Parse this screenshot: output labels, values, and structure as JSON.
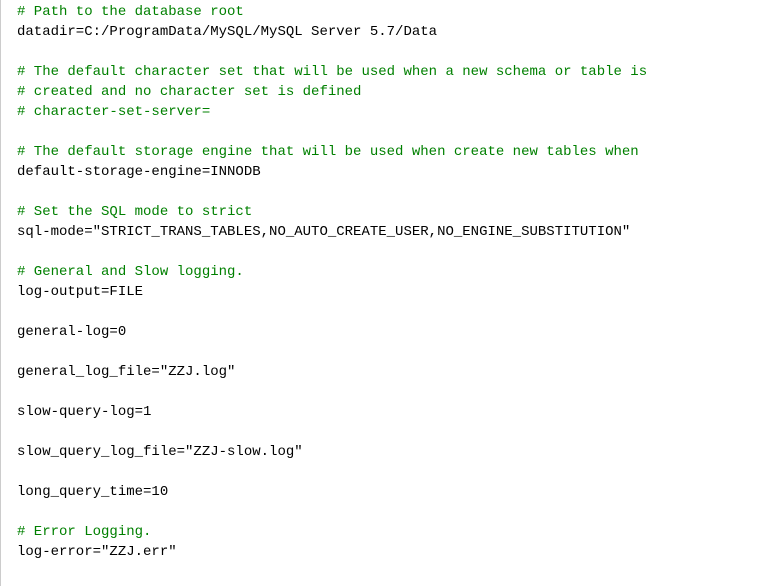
{
  "lines": [
    {
      "type": "comment",
      "text": "# Path to the database root"
    },
    {
      "type": "config",
      "text": "datadir=C:/ProgramData/MySQL/MySQL Server 5.7/Data"
    },
    {
      "type": "blank",
      "text": ""
    },
    {
      "type": "comment",
      "text": "# The default character set that will be used when a new schema or table is"
    },
    {
      "type": "comment",
      "text": "# created and no character set is defined"
    },
    {
      "type": "comment",
      "text": "# character-set-server="
    },
    {
      "type": "blank",
      "text": ""
    },
    {
      "type": "comment",
      "text": "# The default storage engine that will be used when create new tables when"
    },
    {
      "type": "config",
      "text": "default-storage-engine=INNODB"
    },
    {
      "type": "blank",
      "text": ""
    },
    {
      "type": "comment",
      "text": "# Set the SQL mode to strict"
    },
    {
      "type": "config",
      "text": "sql-mode=\"STRICT_TRANS_TABLES,NO_AUTO_CREATE_USER,NO_ENGINE_SUBSTITUTION\""
    },
    {
      "type": "blank",
      "text": ""
    },
    {
      "type": "comment",
      "text": "# General and Slow logging."
    },
    {
      "type": "config",
      "text": "log-output=FILE"
    },
    {
      "type": "blank",
      "text": ""
    },
    {
      "type": "config",
      "text": "general-log=0"
    },
    {
      "type": "blank",
      "text": ""
    },
    {
      "type": "config",
      "text": "general_log_file=\"ZZJ.log\""
    },
    {
      "type": "blank",
      "text": ""
    },
    {
      "type": "config",
      "text": "slow-query-log=1"
    },
    {
      "type": "blank",
      "text": ""
    },
    {
      "type": "config",
      "text": "slow_query_log_file=\"ZZJ-slow.log\""
    },
    {
      "type": "blank",
      "text": ""
    },
    {
      "type": "config",
      "text": "long_query_time=10"
    },
    {
      "type": "blank",
      "text": ""
    },
    {
      "type": "comment",
      "text": "# Error Logging."
    },
    {
      "type": "config",
      "text": "log-error=\"ZZJ.err\""
    }
  ]
}
